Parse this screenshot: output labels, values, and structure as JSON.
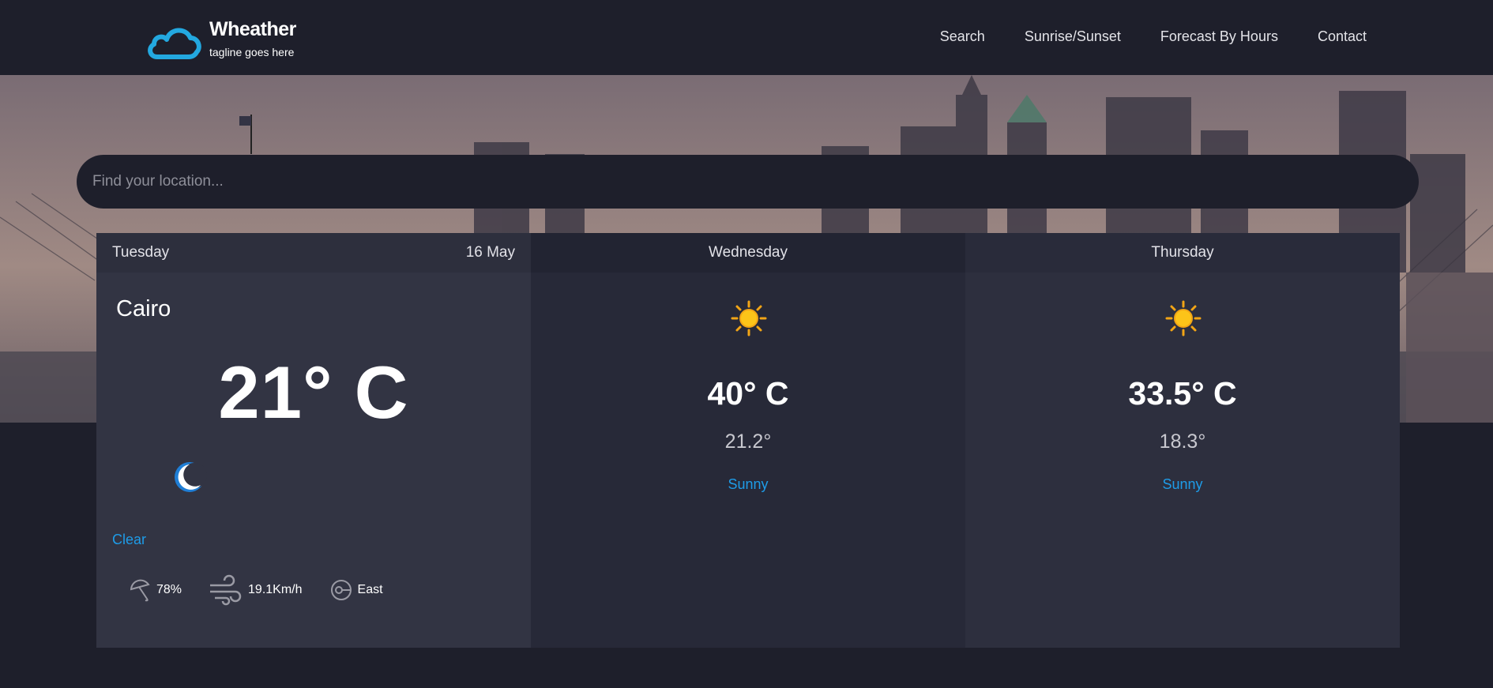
{
  "header": {
    "brand": "Wheather",
    "tagline": "tagline goes here",
    "nav": [
      "Search",
      "Sunrise/Sunset",
      "Forecast By Hours",
      "Contact"
    ]
  },
  "search": {
    "placeholder": "Find your location..."
  },
  "today": {
    "day": "Tuesday",
    "date": "16 May",
    "city": "Cairo",
    "temp": "21° C",
    "icon": "moon-icon",
    "condition": "Clear",
    "humidity": "78%",
    "wind_speed": "19.1Km/h",
    "wind_dir": "East"
  },
  "days": [
    {
      "day": "Wednesday",
      "icon": "sun-icon",
      "max": "40° C",
      "min": "21.2°",
      "condition": "Sunny"
    },
    {
      "day": "Thursday",
      "icon": "sun-icon",
      "max": "33.5° C",
      "min": "18.3°",
      "condition": "Sunny"
    }
  ],
  "colors": {
    "accent": "#1e9ce8",
    "bg": "#1e1f2b",
    "card": "#323443"
  }
}
